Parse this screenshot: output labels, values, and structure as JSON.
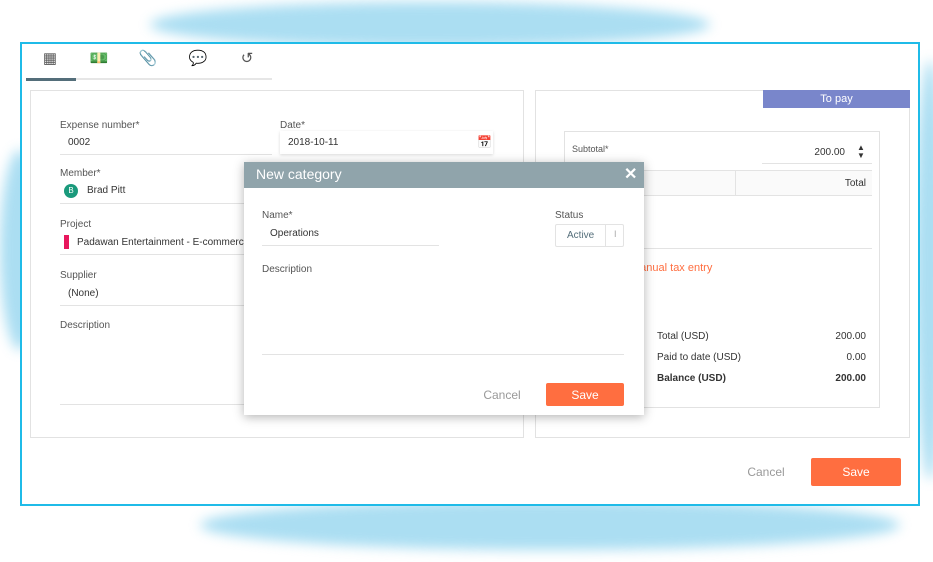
{
  "tabs": [
    {
      "icon": "calculator-icon",
      "active": true
    },
    {
      "icon": "money-icon"
    },
    {
      "icon": "paperclip-icon"
    },
    {
      "icon": "comments-icon"
    },
    {
      "icon": "history-icon"
    }
  ],
  "form": {
    "expense_number": {
      "label": "Expense number*",
      "value": "0002"
    },
    "date": {
      "label": "Date*",
      "value": "2018-10-11"
    },
    "member": {
      "label": "Member*",
      "avatar": "B",
      "value": "Brad Pitt",
      "avatar_color": "#1a9a7c"
    },
    "project": {
      "label": "Project",
      "value": "Padawan Entertainment - E-commerce s",
      "color": "#e8175d"
    },
    "supplier": {
      "label": "Supplier",
      "value": "(None)"
    },
    "description": {
      "label": "Description"
    }
  },
  "summary": {
    "status_tab": "To pay",
    "status_color": "#7986cb",
    "subtotal": {
      "label": "Subtotal*",
      "value": "200.00"
    },
    "table_header": {
      "total": "Total"
    },
    "manual_tax": "Manual tax entry",
    "totals": [
      {
        "label": "Total (USD)",
        "value": "200.00"
      },
      {
        "label": "Paid to date (USD)",
        "value": "0.00"
      },
      {
        "label": "Balance (USD)",
        "value": "200.00",
        "bold": true
      }
    ]
  },
  "footer": {
    "cancel": "Cancel",
    "save": "Save"
  },
  "dialog": {
    "title": "New category",
    "name": {
      "label": "Name*",
      "value": "Operations"
    },
    "status": {
      "label": "Status",
      "value": "Active"
    },
    "description": {
      "label": "Description"
    },
    "cancel": "Cancel",
    "save": "Save"
  },
  "colors": {
    "accent": "#ff6e40",
    "frame": "#1fbbe8",
    "dialog_header": "#90a4ab"
  }
}
